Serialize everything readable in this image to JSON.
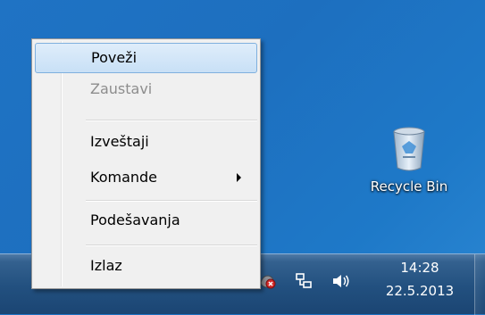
{
  "desktop": {
    "recycle_bin_label": "Recycle Bin"
  },
  "context_menu": {
    "items": [
      {
        "label": "Poveži",
        "state": "highlighted"
      },
      {
        "label": "Zaustavi",
        "state": "disabled"
      },
      {
        "label": "Izveštaji",
        "state": "normal"
      },
      {
        "label": "Komande",
        "state": "normal",
        "submenu": true
      },
      {
        "label": "Podešavanja",
        "state": "normal"
      },
      {
        "label": "Izlaz",
        "state": "normal"
      }
    ]
  },
  "taskbar": {
    "tray_icons": [
      "app-tray-icon",
      "network-icon",
      "volume-icon"
    ],
    "clock": {
      "time": "14:28",
      "date": "22.5.2013"
    }
  },
  "colors": {
    "desktop": "#1f73c4",
    "menu_background": "#f0f0f0",
    "menu_highlight": "#c8e0f6",
    "disabled_text": "#8d8d8d"
  }
}
